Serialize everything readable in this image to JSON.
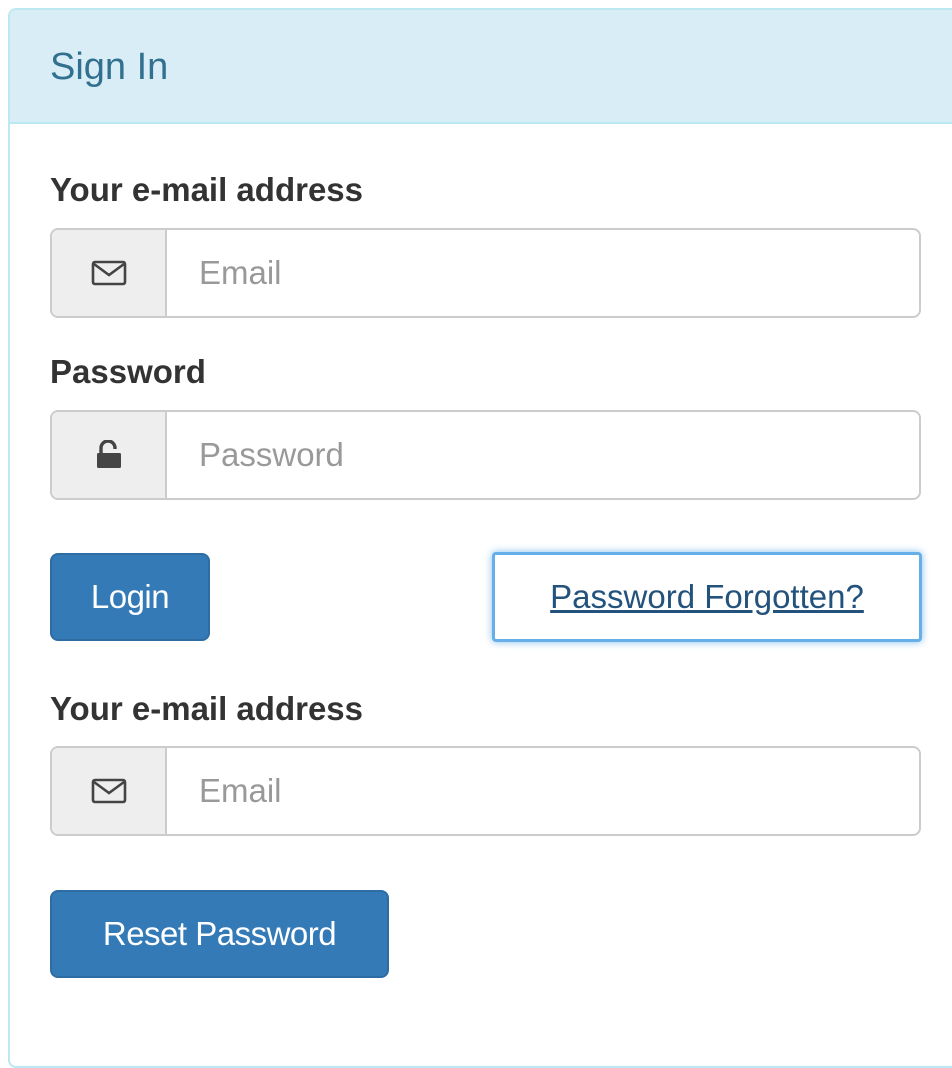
{
  "panel": {
    "title": "Sign In"
  },
  "login_form": {
    "email_label": "Your e-mail address",
    "email_placeholder": "Email",
    "email_icon": "envelope-icon",
    "password_label": "Password",
    "password_placeholder": "Password",
    "password_icon": "lock-icon",
    "login_button": "Login",
    "forgot_link": "Password Forgotten?"
  },
  "reset_form": {
    "email_label": "Your e-mail address",
    "email_placeholder": "Email",
    "email_icon": "envelope-icon",
    "reset_button": "Reset Password"
  },
  "colors": {
    "heading_bg": "#d9edf7",
    "heading_text": "#31708f",
    "border": "#bce8f1",
    "primary": "#337ab7",
    "link": "#23527c",
    "focus": "#66afe9"
  }
}
